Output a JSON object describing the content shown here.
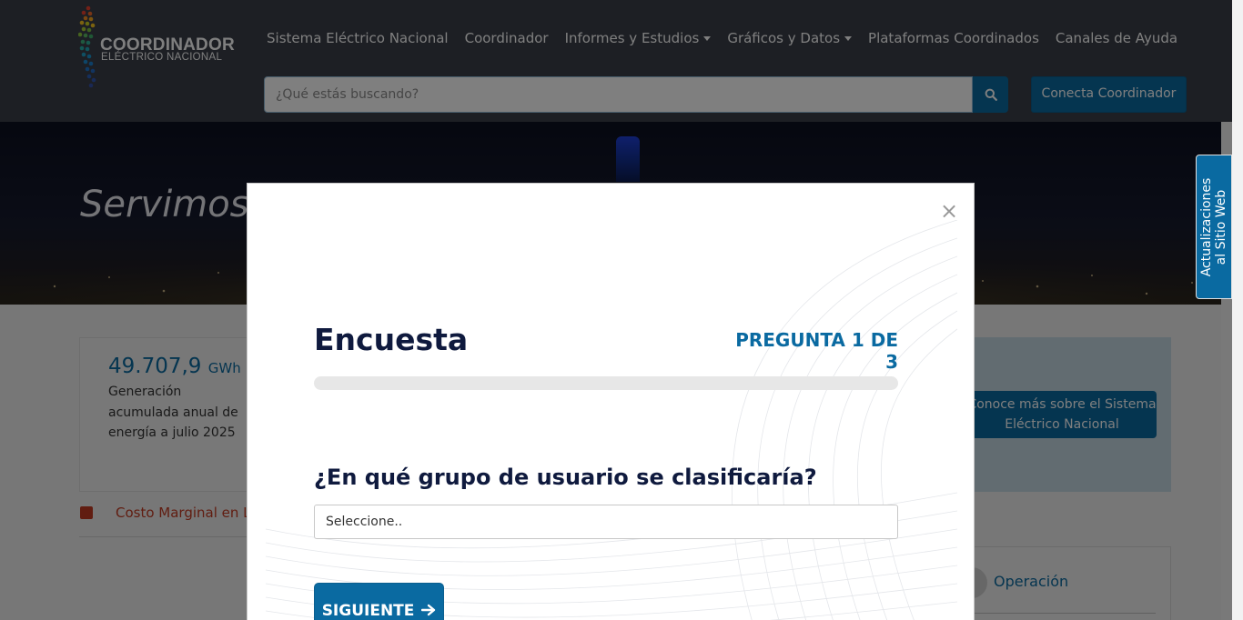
{
  "header": {
    "logo": {
      "line1": "COORDINADOR",
      "line2": "ELÉCTRICO NACIONAL"
    },
    "nav": [
      {
        "label": "Sistema Eléctrico Nacional",
        "dropdown": false
      },
      {
        "label": "Coordinador",
        "dropdown": false
      },
      {
        "label": "Informes y Estudios",
        "dropdown": true
      },
      {
        "label": "Gráficos y Datos",
        "dropdown": true
      },
      {
        "label": "Plataformas Coordinados",
        "dropdown": false
      },
      {
        "label": "Canales de Ayuda",
        "dropdown": false
      }
    ],
    "search": {
      "placeholder": "¿Qué estás buscando?"
    },
    "conecta_label": "Conecta Coordinador"
  },
  "hero": {
    "title": "Servimos"
  },
  "side_tab": {
    "line1": "Actualizaciones",
    "line2": "al Sitio Web"
  },
  "main": {
    "kpi": {
      "value": "49.707,9",
      "unit": "GWh",
      "description": "Generación acumulada anual de energía a julio 2025"
    },
    "conoce_label": "Conoce más sobre el Sistema Eléctrico Nacional",
    "cmg_label": "Costo Marginal en L",
    "operacion_label": "Operación"
  },
  "modal": {
    "title": "Encuesta",
    "progress_label": "PREGUNTA 1 DE 3",
    "progress": {
      "current": 1,
      "total": 3
    },
    "question": "¿En qué grupo de usuario se clasificaría?",
    "select_value": "Seleccione..",
    "next_label": "SIGUIENTE",
    "close_symbol": "×"
  },
  "colors": {
    "header_bg": "#3a3e48",
    "primary": "#0a6aa1",
    "title_dark": "#0f1a3e",
    "accent_red": "#c23b22"
  },
  "icons": [
    "search-icon",
    "close-icon",
    "arrow-right-icon",
    "bar-chart-icon"
  ]
}
